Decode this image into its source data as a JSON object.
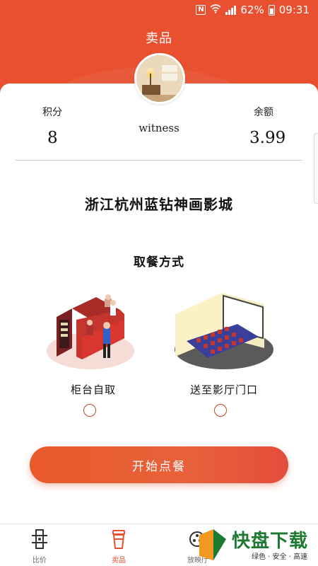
{
  "status_bar": {
    "nfc": "N",
    "battery": "62%",
    "time": "09:31"
  },
  "header": {
    "title": "卖品"
  },
  "profile": {
    "points_label": "积分",
    "points_value": "8",
    "balance_label": "余额",
    "balance_value": "3.99",
    "username": "witness"
  },
  "cinema": {
    "name": "浙江杭州蓝钻神画影城"
  },
  "pickup": {
    "title": "取餐方式",
    "options": [
      {
        "label": "柜台自取",
        "selected": false
      },
      {
        "label": "送至影厅门口",
        "selected": false
      }
    ]
  },
  "actions": {
    "start_order": "开始点餐"
  },
  "bottom_nav": {
    "items": [
      {
        "label": "比价",
        "icon": "film-strip-icon",
        "active": false
      },
      {
        "label": "卖品",
        "icon": "drink-cup-icon",
        "active": true
      },
      {
        "label": "放映厅",
        "icon": "film-reel-icon",
        "active": false
      }
    ]
  },
  "watermark": {
    "brand": "快盘下载",
    "tagline": "绿色 · 安全 · 高速"
  },
  "colors": {
    "primary": "#e8502f",
    "radio": "#c0452c"
  }
}
